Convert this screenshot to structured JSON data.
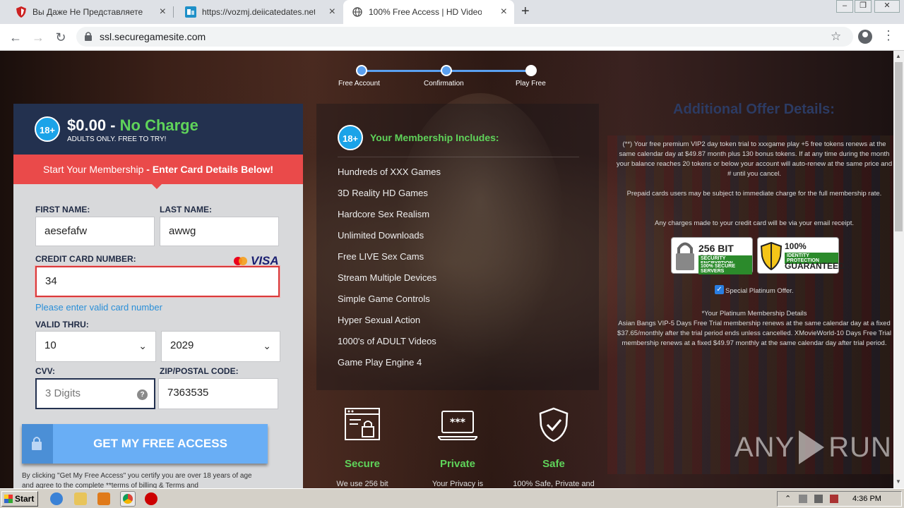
{
  "browser": {
    "tabs": [
      {
        "title": "Вы Даже Не Представляете Что М",
        "icon": "shield-icon"
      },
      {
        "title": "https://vozmj.deiicatedates.net/c/d",
        "icon": "site-icon"
      },
      {
        "title": "100% Free Access | HD Videos",
        "icon": "globe-icon"
      }
    ],
    "url": "ssl.securegamesite.com"
  },
  "steps": [
    "Free Account",
    "Confirmation",
    "Play Free"
  ],
  "form": {
    "badge": "18+",
    "price": "$0.00 -",
    "no_charge": "No Charge",
    "adults": "ADULTS ONLY. FREE TO TRY!",
    "banner_start": "Start Your Membership",
    "banner_bold": "- Enter Card Details Below!",
    "first_name_label": "FIRST NAME:",
    "first_name_value": "aesefafw",
    "last_name_label": "LAST NAME:",
    "last_name_value": "awwg",
    "cc_label": "CREDIT CARD NUMBER:",
    "cc_value": "34",
    "cc_error": "Please enter valid card number",
    "visa": "VISA",
    "valid_label": "VALID THRU:",
    "month": "10",
    "year": "2029",
    "cvv_label": "CVV:",
    "cvv_placeholder": "3 Digits",
    "zip_label": "ZIP/POSTAL CODE:",
    "zip_value": "7363535",
    "cta": "GET MY FREE ACCESS",
    "terms": "By clicking \"Get My Free Access\" you certify you are over 18 years of age and agree to the complete **terms of billing & Terms and"
  },
  "membership": {
    "badge": "18+",
    "title": "Your Membership Includes:",
    "features": [
      "Hundreds of XXX Games",
      "3D Reality HD Games",
      "Hardcore Sex Realism",
      "Unlimited Downloads",
      "Free LIVE Sex Cams",
      "Stream Multiple Devices",
      "Simple Game Controls",
      "Hyper Sexual Action",
      "1000's of ADULT Videos",
      "Game Play Engine 4"
    ]
  },
  "perks": [
    {
      "title": "Secure",
      "desc": "We use 256 bit",
      "icon": "secure-browser-icon"
    },
    {
      "title": "Private",
      "desc": "Your Privacy is",
      "icon": "password-laptop-icon"
    },
    {
      "title": "Safe",
      "desc": "100% Safe, Private and",
      "icon": "shield-check-icon"
    }
  ],
  "details": {
    "title": "Additional Offer Details:",
    "p1": "(**) Your free premium VIP2 day token trial to xxxgame play +5 free tokens renews at the same calendar day at $49.87 month plus 130 bonus tokens. If at any time during the month your balance reaches 20 tokens or below your account will auto-renew at the same price and # until you cancel.",
    "p2": "Prepaid cards users may be subject to immediate charge for the full membership rate.",
    "p3": "Any charges made to your credit card will be via your email receipt.",
    "seal1_big": "256 BIT SSL",
    "seal1_sub1": "SECURITY ENCRYPTION",
    "seal1_sub2": "100% SECURE SERVERS",
    "seal2_big": "100% PRIVACY",
    "seal2_sub": "IDENTITY PROTECTION",
    "seal2_big2": "GUARANTEED",
    "checkbox_label": "Special Platinum Offer.",
    "p4_title": "*Your Platinum Membership Details",
    "p4": "Asian Bangs VIP-5 Days Free Trial membership renews at the same calendar day at a fixed $37.65/monthly after the trial period ends unless cancelled. XMovieWorld-10 Days Free Trial membership renews at a fixed $49.97 monthly at the same calendar day after trial period."
  },
  "watermark": {
    "left": "ANY",
    "right": "RUN"
  },
  "taskbar": {
    "start": "Start",
    "clock": "4:36 PM"
  },
  "colors": {
    "accent_green": "#5fd35a",
    "banner_red": "#ea4a4a",
    "cta_blue": "#69aef5",
    "navy": "#23314f"
  }
}
